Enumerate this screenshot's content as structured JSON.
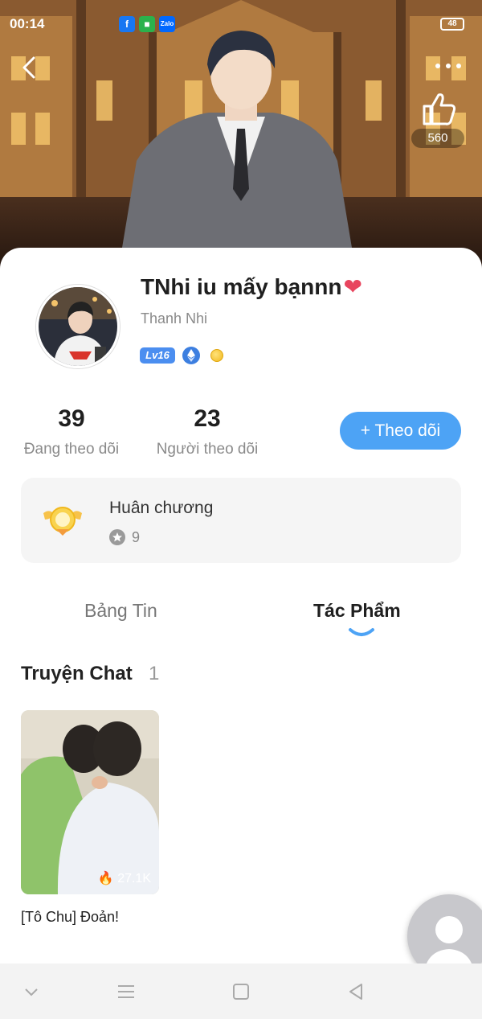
{
  "status_bar": {
    "time": "00:14",
    "battery": "48"
  },
  "cover": {
    "like_count": "560"
  },
  "profile": {
    "display_name": "TNhi iu mấy bạnnn",
    "heart_emoji": "❤",
    "username": "Thanh Nhi",
    "level": "Lv16"
  },
  "stats": {
    "following_count": "39",
    "following_label": "Đang theo dõi",
    "followers_count": "23",
    "followers_label": "Người theo dõi"
  },
  "follow_button": {
    "label": "+ Theo dõi"
  },
  "medal": {
    "title": "Huân chương",
    "count": "9"
  },
  "tabs": [
    {
      "label": "Bảng Tin",
      "active": false
    },
    {
      "label": "Tác Phẩm",
      "active": true
    }
  ],
  "section": {
    "title": "Truyện Chat",
    "count": "1"
  },
  "stories": [
    {
      "title": "[Tô Chu] Đoản!",
      "views": "27.1K"
    }
  ],
  "colors": {
    "accent": "#4da3f5",
    "level_badge": "#4b8ef0",
    "indicator": "#4da3f5"
  }
}
